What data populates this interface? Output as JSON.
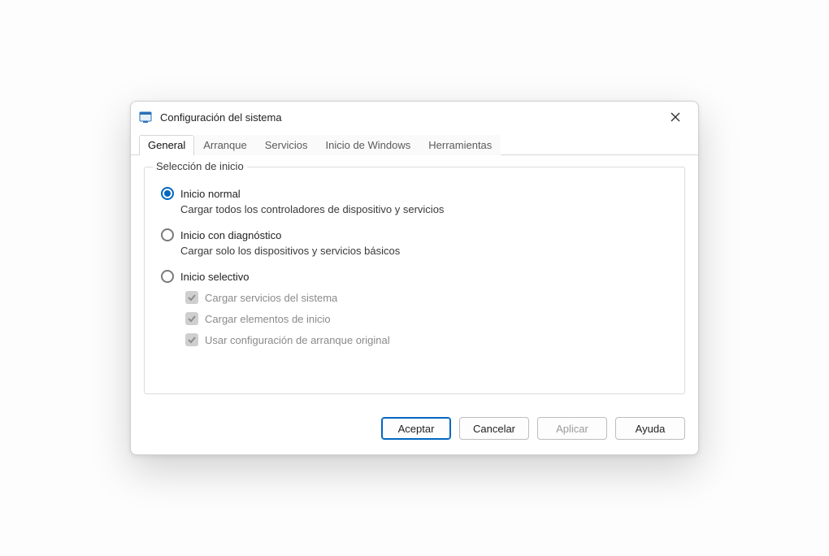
{
  "window": {
    "title": "Configuración del sistema"
  },
  "tabs": [
    {
      "label": "General",
      "active": true
    },
    {
      "label": "Arranque",
      "active": false
    },
    {
      "label": "Servicios",
      "active": false
    },
    {
      "label": "Inicio de Windows",
      "active": false
    },
    {
      "label": "Herramientas",
      "active": false
    }
  ],
  "group": {
    "legend": "Selección de inicio",
    "options": [
      {
        "label": "Inicio normal",
        "desc": "Cargar todos los controladores de dispositivo y servicios",
        "checked": true
      },
      {
        "label": "Inicio con diagnóstico",
        "desc": "Cargar solo los dispositivos y servicios básicos",
        "checked": false
      },
      {
        "label": "Inicio selectivo",
        "desc": "",
        "checked": false,
        "sub": [
          {
            "label": "Cargar servicios del sistema",
            "checked": true,
            "disabled": true
          },
          {
            "label": "Cargar elementos de inicio",
            "checked": true,
            "disabled": true
          },
          {
            "label": "Usar configuración de arranque original",
            "checked": true,
            "disabled": true
          }
        ]
      }
    ]
  },
  "buttons": {
    "ok": "Aceptar",
    "cancel": "Cancelar",
    "apply": "Aplicar",
    "help": "Ayuda"
  }
}
